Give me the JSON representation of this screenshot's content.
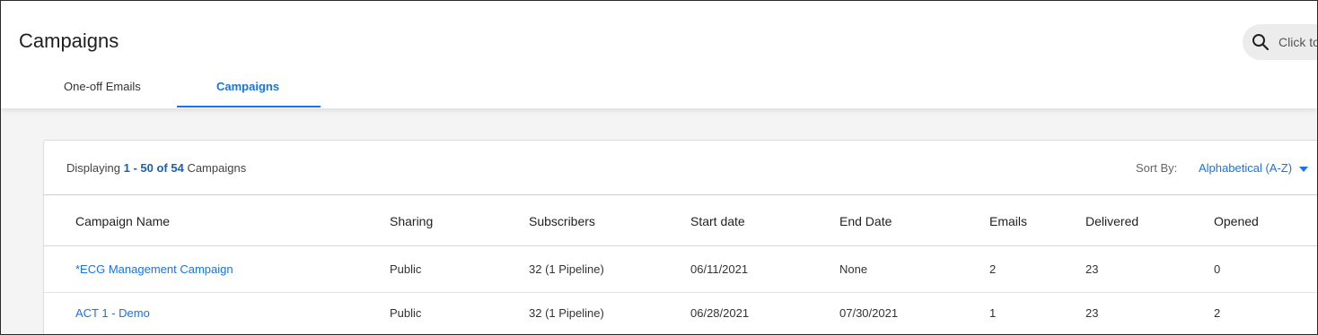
{
  "header": {
    "title": "Campaigns",
    "search_placeholder": "Click to",
    "tabs": [
      {
        "label": "One-off Emails",
        "active": false
      },
      {
        "label": "Campaigns",
        "active": true
      }
    ]
  },
  "listing": {
    "displaying_prefix": "Displaying",
    "displaying_range": "1 - 50 of 54",
    "displaying_suffix": "Campaigns",
    "sort_label": "Sort By:",
    "sort_value": "Alphabetical (A-Z)"
  },
  "table": {
    "columns": [
      "Campaign Name",
      "Sharing",
      "Subscribers",
      "Start date",
      "End Date",
      "Emails",
      "Delivered",
      "Opened"
    ],
    "rows": [
      [
        "*ECG Management Campaign",
        "Public",
        "32 (1 Pipeline)",
        "06/11/2021",
        "None",
        "2",
        "23",
        "0"
      ],
      [
        "ACT 1 - Demo",
        "Public",
        "32 (1 Pipeline)",
        "06/28/2021",
        "07/30/2021",
        "1",
        "23",
        "2"
      ]
    ]
  },
  "colors": {
    "accent": "#1a73e8",
    "background": "#f4f4f4"
  }
}
